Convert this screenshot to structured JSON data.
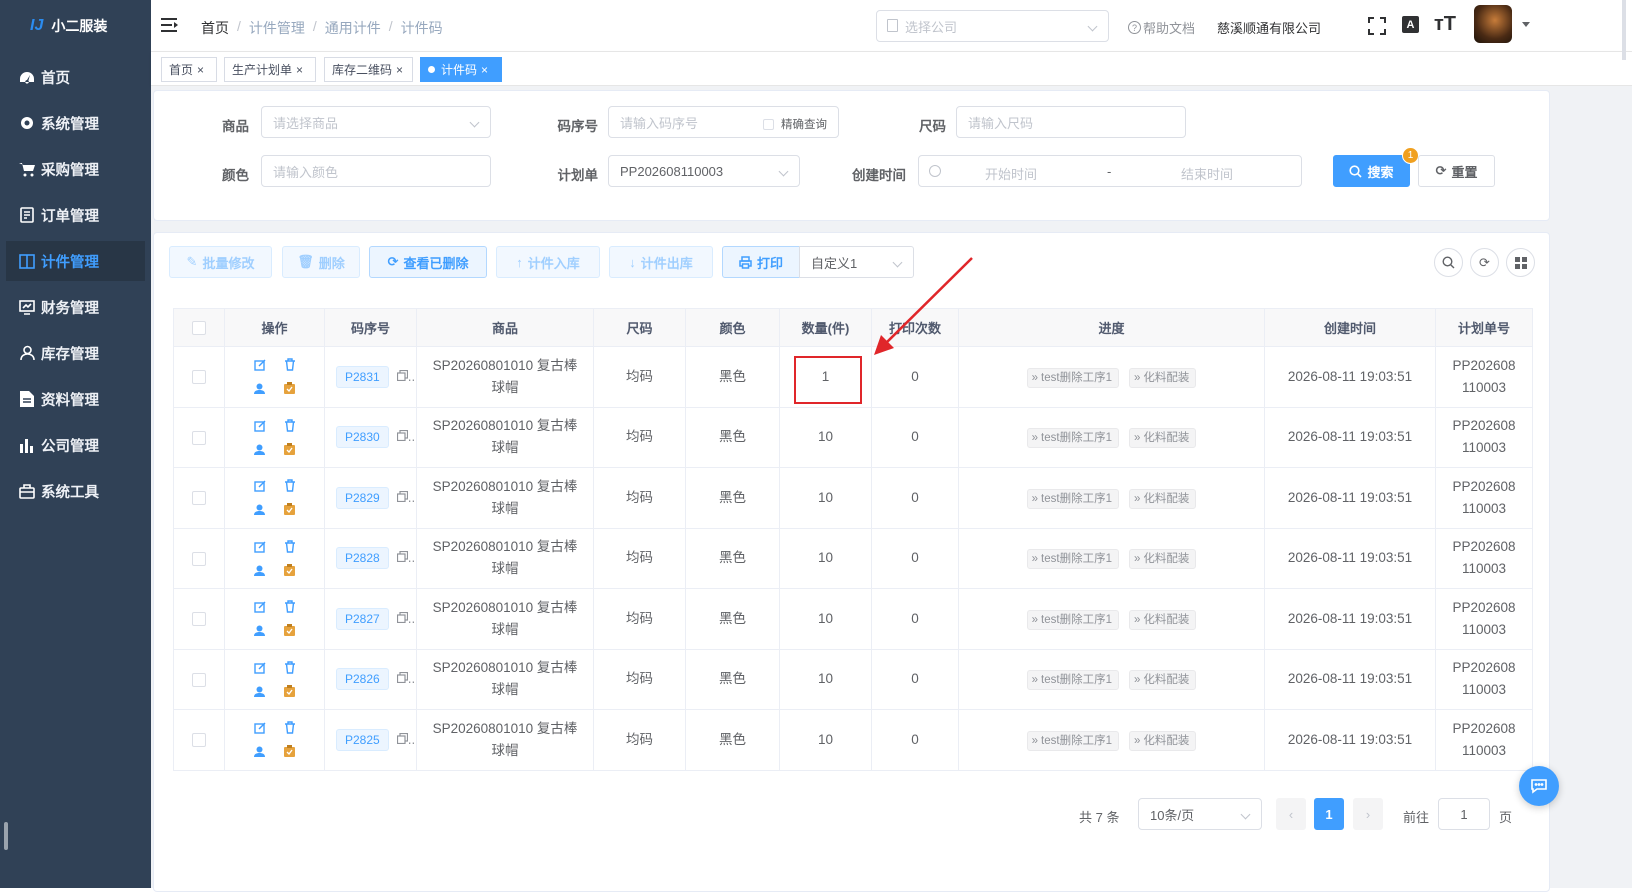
{
  "app": {
    "name": "小二服装"
  },
  "sidebar": {
    "items": [
      {
        "label": "首页",
        "icon": "dashboard-icon"
      },
      {
        "label": "系统管理",
        "icon": "gear-icon"
      },
      {
        "label": "采购管理",
        "icon": "cart-icon"
      },
      {
        "label": "订单管理",
        "icon": "order-icon"
      },
      {
        "label": "计件管理",
        "icon": "book-icon",
        "active": true
      },
      {
        "label": "财务管理",
        "icon": "monitor-icon"
      },
      {
        "label": "库存管理",
        "icon": "user-icon"
      },
      {
        "label": "资料管理",
        "icon": "document-icon"
      },
      {
        "label": "公司管理",
        "icon": "bar-chart-icon"
      },
      {
        "label": "系统工具",
        "icon": "toolbox-icon"
      }
    ]
  },
  "header": {
    "breadcrumb": [
      "首页",
      "计件管理",
      "通用计件",
      "计件码"
    ],
    "company_select_placeholder": "选择公司",
    "help": "帮助文档",
    "company_name": "慈溪顺通有限公司"
  },
  "tags": [
    "首页",
    "生产计划单",
    "库存二维码",
    "计件码"
  ],
  "filters": {
    "product_label": "商品",
    "product_placeholder": "请选择商品",
    "code_label": "码序号",
    "code_placeholder": "请输入码序号",
    "exact_label": "精确查询",
    "size_label": "尺码",
    "size_placeholder": "请输入尺码",
    "color_label": "颜色",
    "color_placeholder": "请输入颜色",
    "plan_label": "计划单",
    "plan_value": "PP202608110003",
    "created_label": "创建时间",
    "start_placeholder": "开始时间",
    "range_sep": "-",
    "end_placeholder": "结束时间",
    "search_label": "搜索",
    "search_badge": "1",
    "reset_label": "重置"
  },
  "toolbar": {
    "batch_edit": "批量修改",
    "delete": "删除",
    "view_deleted": "查看已删除",
    "stock_in": "计件入库",
    "stock_out": "计件出库",
    "print": "打印",
    "template": "自定义1"
  },
  "table": {
    "columns": [
      "操作",
      "码序号",
      "商品",
      "尺码",
      "颜色",
      "数量(件)",
      "打印次数",
      "进度",
      "创建时间",
      "计划单号"
    ],
    "rows": [
      {
        "code": "P2831",
        "product_l1": "SP20260801010 复古棒",
        "product_l2": "球帽",
        "size": "均码",
        "color": "黑色",
        "qty": "1",
        "prints": "0",
        "steps": [
          "test删除工序1",
          "化料配装"
        ],
        "created": "2026-08-11 19:03:51",
        "plan_l1": "PP202608",
        "plan_l2": "110003"
      },
      {
        "code": "P2830",
        "product_l1": "SP20260801010 复古棒",
        "product_l2": "球帽",
        "size": "均码",
        "color": "黑色",
        "qty": "10",
        "prints": "0",
        "steps": [
          "test删除工序1",
          "化料配装"
        ],
        "created": "2026-08-11 19:03:51",
        "plan_l1": "PP202608",
        "plan_l2": "110003"
      },
      {
        "code": "P2829",
        "product_l1": "SP20260801010 复古棒",
        "product_l2": "球帽",
        "size": "均码",
        "color": "黑色",
        "qty": "10",
        "prints": "0",
        "steps": [
          "test删除工序1",
          "化料配装"
        ],
        "created": "2026-08-11 19:03:51",
        "plan_l1": "PP202608",
        "plan_l2": "110003"
      },
      {
        "code": "P2828",
        "product_l1": "SP20260801010 复古棒",
        "product_l2": "球帽",
        "size": "均码",
        "color": "黑色",
        "qty": "10",
        "prints": "0",
        "steps": [
          "test删除工序1",
          "化料配装"
        ],
        "created": "2026-08-11 19:03:51",
        "plan_l1": "PP202608",
        "plan_l2": "110003"
      },
      {
        "code": "P2827",
        "product_l1": "SP20260801010 复古棒",
        "product_l2": "球帽",
        "size": "均码",
        "color": "黑色",
        "qty": "10",
        "prints": "0",
        "steps": [
          "test删除工序1",
          "化料配装"
        ],
        "created": "2026-08-11 19:03:51",
        "plan_l1": "PP202608",
        "plan_l2": "110003"
      },
      {
        "code": "P2826",
        "product_l1": "SP20260801010 复古棒",
        "product_l2": "球帽",
        "size": "均码",
        "color": "黑色",
        "qty": "10",
        "prints": "0",
        "steps": [
          "test删除工序1",
          "化料配装"
        ],
        "created": "2026-08-11 19:03:51",
        "plan_l1": "PP202608",
        "plan_l2": "110003"
      },
      {
        "code": "P2825",
        "product_l1": "SP20260801010 复古棒",
        "product_l2": "球帽",
        "size": "均码",
        "color": "黑色",
        "qty": "10",
        "prints": "0",
        "steps": [
          "test删除工序1",
          "化料配装"
        ],
        "created": "2026-08-11 19:03:51",
        "plan_l1": "PP202608",
        "plan_l2": "110003"
      }
    ]
  },
  "pagination": {
    "total": "共 7 条",
    "page_size": "10条/页",
    "current": "1",
    "goto_label": "前往",
    "goto_value": "1",
    "page_unit": "页"
  },
  "colors": {
    "sidebar": "#304156",
    "accent": "#409eff",
    "annotation": "#e0262a"
  }
}
